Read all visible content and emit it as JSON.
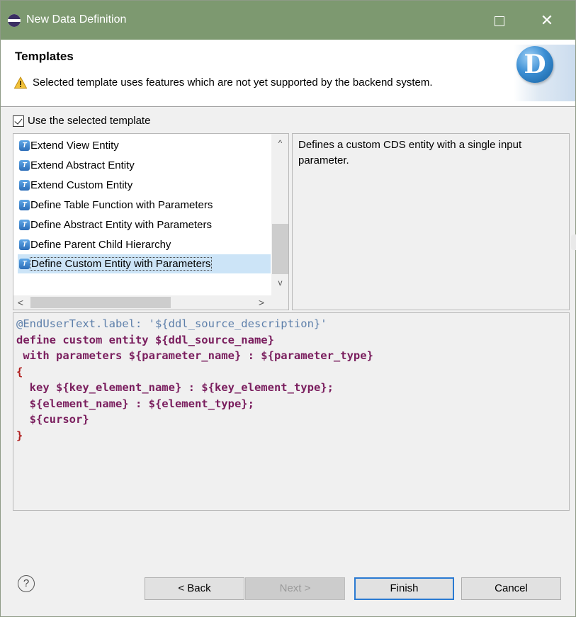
{
  "window": {
    "title": "New Data Definition",
    "maximize_icon": "maximize-icon",
    "close_icon": "close-icon",
    "close_glyph": "✕"
  },
  "header": {
    "page_title": "Templates",
    "warning_text": "Selected template uses features which are not yet supported by the backend system.",
    "logo_letter": "D"
  },
  "use_template": {
    "label": "Use the selected template",
    "checked": true
  },
  "templates": {
    "items": [
      "Extend View Entity",
      "Extend Abstract Entity",
      "Extend Custom Entity",
      "Define Table Function with Parameters",
      "Define Abstract Entity with Parameters",
      "Define Parent Child Hierarchy",
      "Define Custom Entity with Parameters"
    ],
    "selected_index": 6,
    "scroll_up": "^",
    "scroll_down": "v",
    "scroll_left": "<",
    "scroll_right": ">"
  },
  "description": "Defines a custom CDS entity with a single input parameter.",
  "code": {
    "line1": "@EndUserText.label: '${ddl_source_description}'",
    "line2_kw": "define custom entity ",
    "line2_rest": "${ddl_source_name}",
    "line3_kw": " with parameters ",
    "line3_rest": "${parameter_name} : ${parameter_type}",
    "line4": "{",
    "line5_kw": "  key ",
    "line5_rest": "${key_element_name} : ${key_element_type};",
    "line6": "  ${element_name} : ${element_type};",
    "line7": "  ${cursor}",
    "line8": "}"
  },
  "footer": {
    "help_glyph": "?",
    "back_label": "< Back",
    "next_label": "Next >",
    "finish_label": "Finish",
    "cancel_label": "Cancel"
  },
  "colors": {
    "title_bar": "#7d9970",
    "selection": "#cce4f7",
    "focus_border": "#2a7ad2",
    "annotation": "#5d7faa",
    "keyword": "#7a1e5e"
  }
}
